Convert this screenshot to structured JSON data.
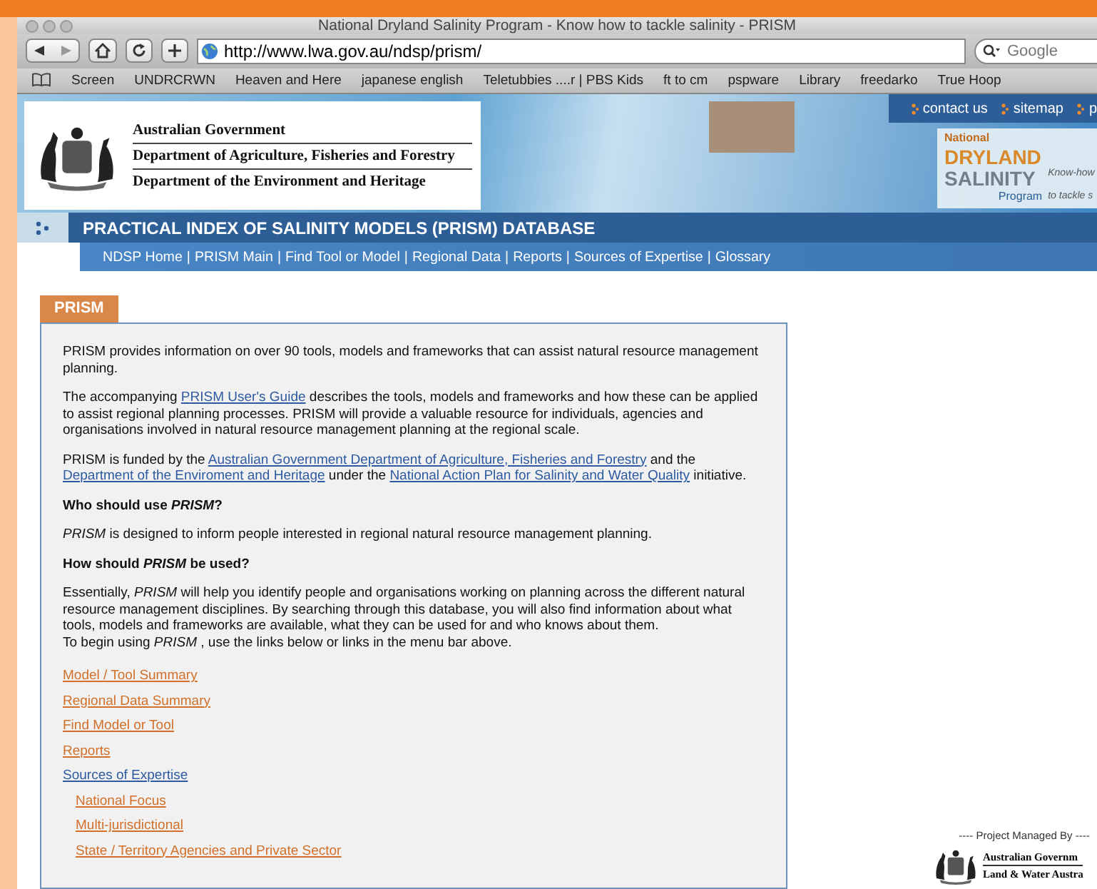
{
  "window": {
    "title": "National Dryland Salinity Program - Know how to tackle salinity - PRISM"
  },
  "toolbar": {
    "url": "http://www.lwa.gov.au/ndsp/prism/",
    "search": {
      "placeholder": "Google"
    }
  },
  "bookmarks": [
    "Screen",
    "UNDRCRWN",
    "Heaven and Here",
    "japanese english",
    "Teletubbies ....r | PBS Kids",
    "ft to cm",
    "pspware",
    "Library",
    "freedarko",
    "True Hoop"
  ],
  "banner": {
    "gov_lines": [
      "Australian Government",
      "Department of Agriculture, Fisheries and Forestry",
      "Department of the Environment and Heritage"
    ],
    "top_links": [
      "contact us",
      "sitemap",
      "p"
    ],
    "program_logo": {
      "line_1": "National",
      "line_2": "DRYLAND",
      "line_3": "SALINITY",
      "line_4": "Program",
      "tagline_1": "Know-how",
      "tagline_2": "to tackle s"
    }
  },
  "nav": {
    "title": "PRACTICAL INDEX OF SALINITY MODELS (PRISM) DATABASE",
    "separator": "|",
    "items": [
      "NDSP Home",
      "PRISM Main",
      "Find Tool or Model",
      "Regional Data",
      "Reports",
      "Sources of Expertise",
      "Glossary"
    ]
  },
  "panel": {
    "tab": "PRISM",
    "blocks": [
      {
        "kind": "para",
        "parts": [
          {
            "kind": "text",
            "text": "PRISM provides information on over 90 tools, models and frameworks that can assist natural resource management planning."
          }
        ]
      },
      {
        "kind": "para",
        "parts": [
          {
            "kind": "text",
            "text": "The accompanying "
          },
          {
            "kind": "link",
            "text": "PRISM User's Guide"
          },
          {
            "kind": "text",
            "text": " describes the tools, models and frameworks and how these can be applied to assist regional planning processes. PRISM will provide a valuable resource for individuals, agencies and organisations involved in natural resource management planning at the regional scale."
          }
        ]
      },
      {
        "kind": "para",
        "parts": [
          {
            "kind": "text",
            "text": "PRISM is funded by the "
          },
          {
            "kind": "link",
            "text": "Australian Government Department of Agriculture, Fisheries and Forestry"
          },
          {
            "kind": "text",
            "text": " and the "
          },
          {
            "kind": "link",
            "text": "Department of the Enviroment and Heritage"
          },
          {
            "kind": "text",
            "text": " under the "
          },
          {
            "kind": "link",
            "text": "National Action Plan for Salinity and Water Quality"
          },
          {
            "kind": "text",
            "text": " initiative."
          }
        ]
      },
      {
        "kind": "heading",
        "text": "Who should use *PRISM*?"
      },
      {
        "kind": "para",
        "parts": [
          {
            "kind": "italic",
            "text": "PRISM"
          },
          {
            "kind": "text",
            "text": " is designed to inform people interested in regional natural resource management planning."
          }
        ]
      },
      {
        "kind": "heading",
        "text": "How should *PRISM* be used?"
      },
      {
        "kind": "para",
        "parts": [
          {
            "kind": "text",
            "text": "Essentially, "
          },
          {
            "kind": "italic",
            "text": "PRISM"
          },
          {
            "kind": "text",
            "text": " will help you identify people and organisations working on planning across the different natural resource management disciplines.  By searching through this database, you will also find information about what tools, models and frameworks are available, what they can be used for and who knows about them."
          },
          {
            "kind": "break"
          },
          {
            "kind": "text",
            "text": "To begin using "
          },
          {
            "kind": "italic",
            "text": "PRISM"
          },
          {
            "kind": "text",
            "text": " , use the links below or links in the menu bar above."
          }
        ]
      }
    ],
    "links": [
      {
        "label": "Model / Tool Summary",
        "visited": false
      },
      {
        "label": "Regional Data Summary",
        "visited": false
      },
      {
        "label": "Find Model or Tool",
        "visited": false
      },
      {
        "label": "Reports",
        "visited": false
      },
      {
        "label": "Sources of Expertise",
        "visited": true,
        "children": [
          {
            "label": "National Focus",
            "visited": false
          },
          {
            "label": "Multi-jurisdictional",
            "visited": false
          },
          {
            "label": "State / Territory Agencies and Private Sector",
            "visited": false
          }
        ]
      }
    ]
  },
  "footer": {
    "caption": "---- Project Managed By ----",
    "logo_lines": [
      "Australian Governm",
      "Land & Water Austra"
    ]
  }
}
